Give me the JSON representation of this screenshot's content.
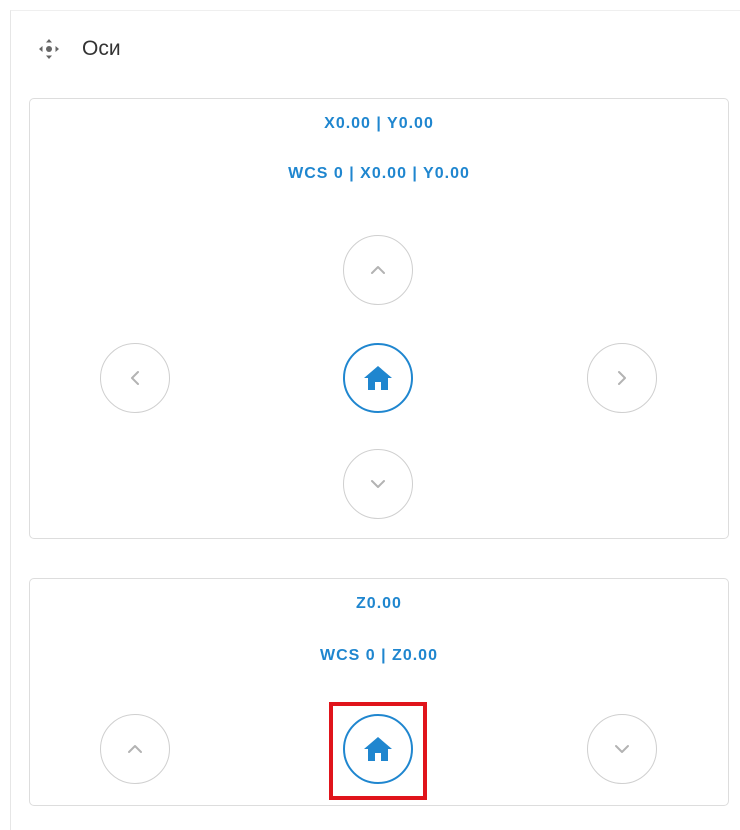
{
  "panel": {
    "title": "Оси",
    "icon": "axes-move-icon"
  },
  "xy_card": {
    "position_readout": "X0.00 | Y0.00",
    "wcs_readout": "WCS 0 | X0.00 | Y0.00",
    "buttons": {
      "up": "chevron-up-icon",
      "left": "chevron-left-icon",
      "home": "home-icon",
      "right": "chevron-right-icon",
      "down": "chevron-down-icon"
    }
  },
  "z_card": {
    "position_readout": "Z0.00",
    "wcs_readout": "WCS 0 | Z0.00",
    "buttons": {
      "up": "chevron-up-icon",
      "home": "home-icon",
      "down": "chevron-down-icon"
    }
  },
  "colors": {
    "accent": "#1f86cf",
    "border": "#dddddd",
    "button_border": "#cfcfcf",
    "chevron": "#b3b3b3",
    "highlight": "#e0141b"
  }
}
